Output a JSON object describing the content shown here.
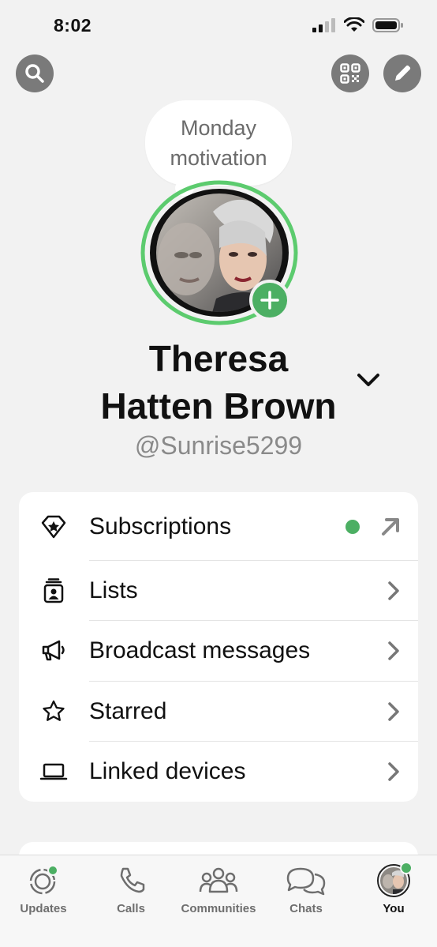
{
  "status_bar": {
    "time": "8:02"
  },
  "header": {
    "search_icon": "search-icon",
    "qr_icon": "qr-code-icon",
    "edit_icon": "pencil-icon"
  },
  "profile": {
    "status_bubble_line1": "Monday",
    "status_bubble_line2": "motivation",
    "name_line1": "Theresa",
    "name_line2": "Hatten Brown",
    "handle": "@Sunrise5299",
    "ring_color": "#5ccb6e",
    "accent_green": "#4caf63"
  },
  "menu": {
    "items": [
      {
        "label": "Subscriptions",
        "icon": "badge-star-icon",
        "trailing": "external-arrow"
      },
      {
        "label": "Lists",
        "icon": "contact-list-icon",
        "trailing": "chevron"
      },
      {
        "label": "Broadcast messages",
        "icon": "megaphone-icon",
        "trailing": "chevron"
      },
      {
        "label": "Starred",
        "icon": "star-icon",
        "trailing": "chevron"
      },
      {
        "label": "Linked devices",
        "icon": "laptop-icon",
        "trailing": "chevron"
      }
    ]
  },
  "tabs": [
    {
      "label": "Updates",
      "icon": "updates-icon",
      "active": false
    },
    {
      "label": "Calls",
      "icon": "phone-icon",
      "active": false
    },
    {
      "label": "Communities",
      "icon": "communities-icon",
      "active": false
    },
    {
      "label": "Chats",
      "icon": "chats-icon",
      "active": false
    },
    {
      "label": "You",
      "icon": "avatar",
      "active": true
    }
  ]
}
